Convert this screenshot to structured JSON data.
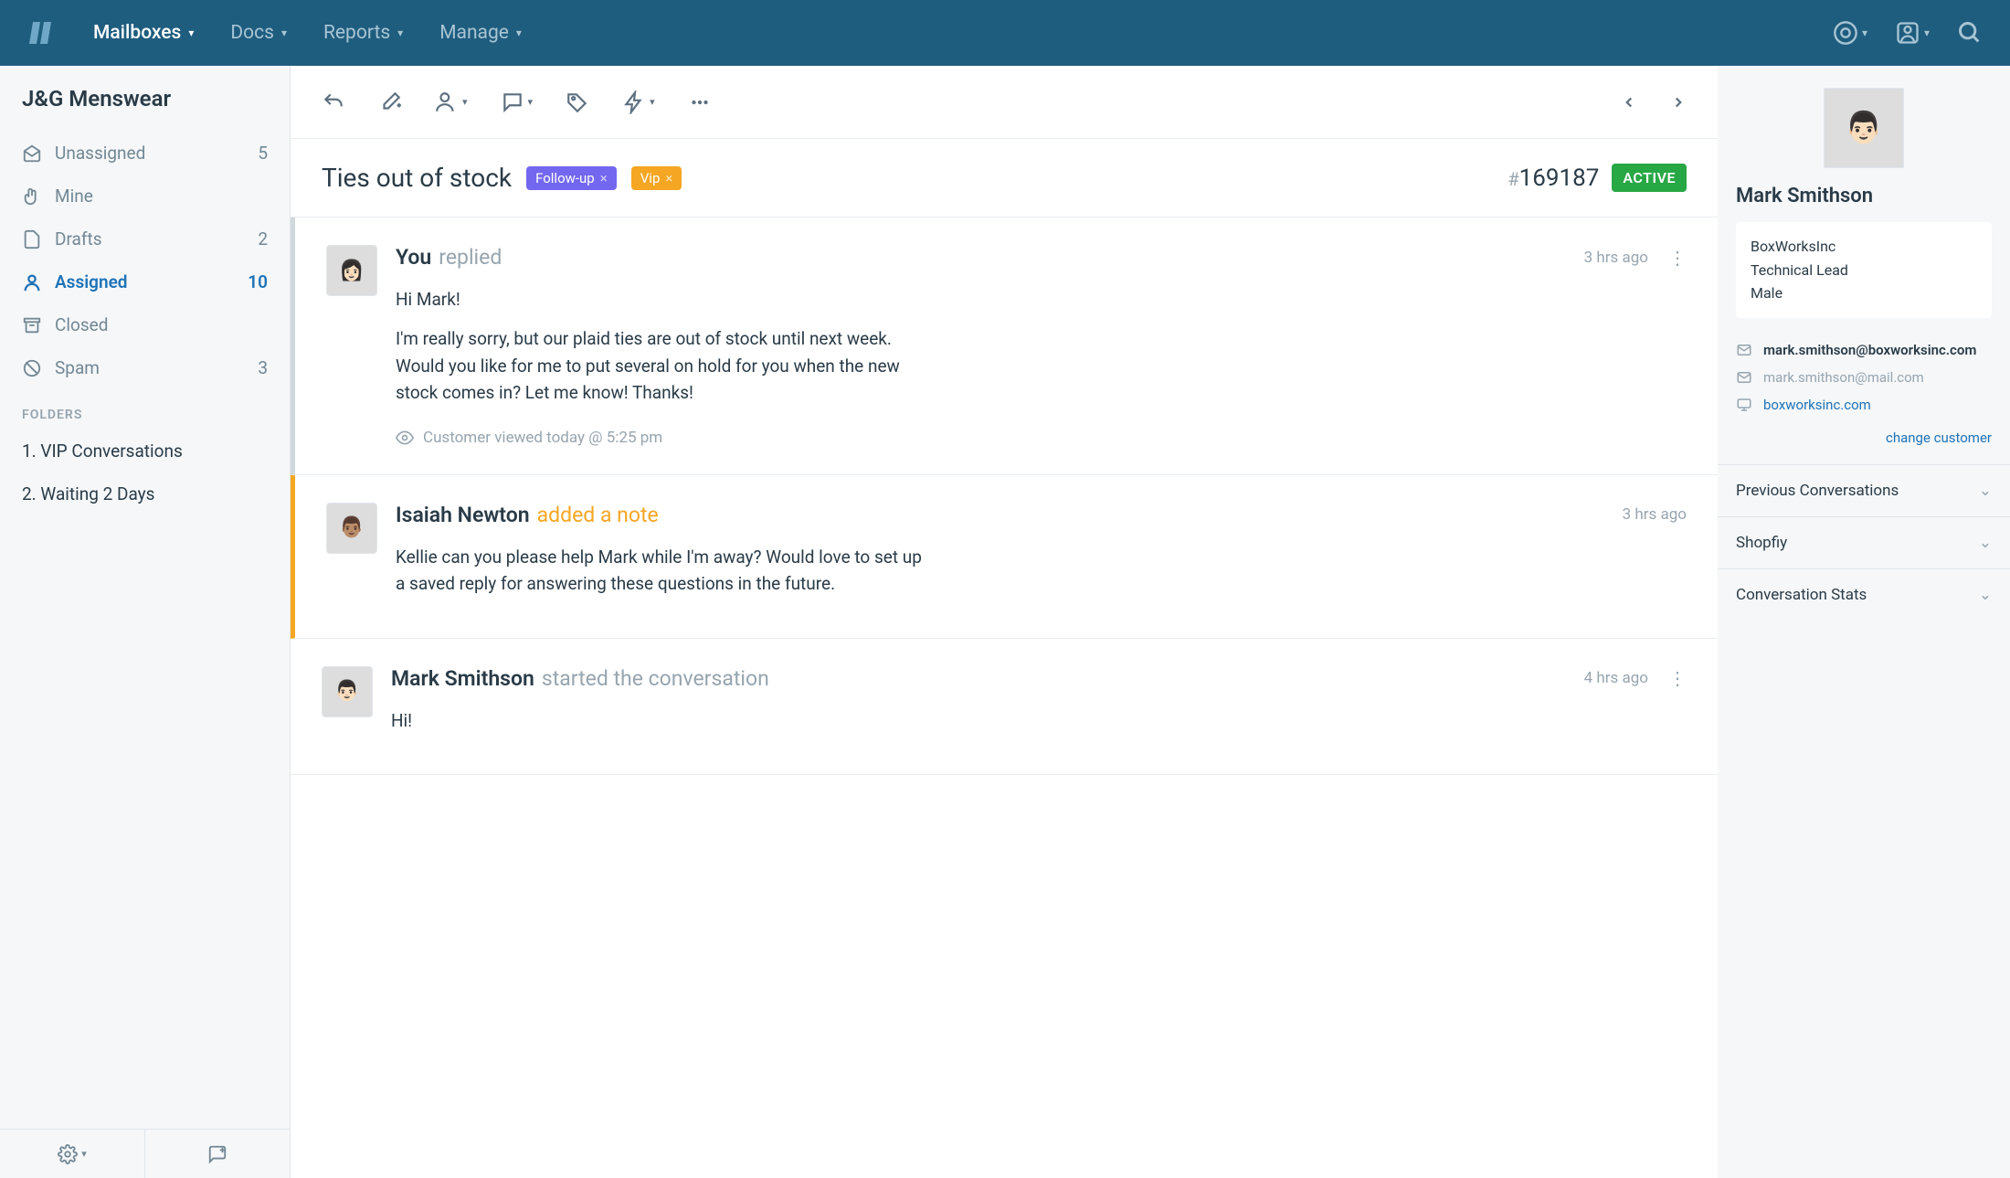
{
  "nav": {
    "items": [
      {
        "label": "Mailboxes",
        "active": true
      },
      {
        "label": "Docs",
        "active": false
      },
      {
        "label": "Reports",
        "active": false
      },
      {
        "label": "Manage",
        "active": false
      }
    ]
  },
  "mailbox": {
    "title": "J&G Menswear",
    "items": [
      {
        "id": "unassigned",
        "label": "Unassigned",
        "count": "5",
        "active": false
      },
      {
        "id": "mine",
        "label": "Mine",
        "count": "",
        "active": false
      },
      {
        "id": "drafts",
        "label": "Drafts",
        "count": "2",
        "active": false
      },
      {
        "id": "assigned",
        "label": "Assigned",
        "count": "10",
        "active": true
      },
      {
        "id": "closed",
        "label": "Closed",
        "count": "",
        "active": false
      },
      {
        "id": "spam",
        "label": "Spam",
        "count": "3",
        "active": false
      }
    ],
    "folders_header": "FOLDERS",
    "folders": [
      {
        "label": "1. VIP Conversations"
      },
      {
        "label": "2. Waiting 2 Days"
      }
    ]
  },
  "conversation": {
    "title": "Ties out of stock",
    "tags": [
      {
        "label": "Follow-up",
        "color": "purple"
      },
      {
        "label": "Vip",
        "color": "orange"
      }
    ],
    "id_hash": "#",
    "id": "169187",
    "status": "ACTIVE",
    "messages": [
      {
        "type": "reply",
        "author": "You",
        "action": "replied",
        "time": "3 hrs ago",
        "paragraphs": [
          "Hi Mark!",
          "I'm really sorry, but our plaid ties are out of stock until next week. Would you like for me to put several on hold for you when the new stock comes in? Let me know! Thanks!"
        ],
        "viewed": "Customer viewed today @ 5:25 pm",
        "avatar_initial": "👩🏻"
      },
      {
        "type": "note",
        "author": "Isaiah Newton",
        "action": "added a note",
        "time": "3 hrs ago",
        "paragraphs": [
          "Kellie can you please help Mark while I'm away? Would love to set up a saved reply for answering these questions in the future."
        ],
        "avatar_initial": "👨🏽"
      },
      {
        "type": "start",
        "author": "Mark Smithson",
        "action": "started the conversation",
        "time": "4 hrs ago",
        "paragraphs": [
          "Hi!"
        ],
        "avatar_initial": "👨🏻"
      }
    ]
  },
  "customer": {
    "name": "Mark Smithson",
    "company": "BoxWorksInc",
    "title": "Technical Lead",
    "gender": "Male",
    "email_primary": "mark.smithson@boxworksinc.com",
    "email_secondary": "mark.smithson@mail.com",
    "website": "boxworksinc.com",
    "change_label": "change customer",
    "accordion": [
      {
        "label": "Previous Conversations"
      },
      {
        "label": "Shopfiy"
      },
      {
        "label": "Conversation Stats"
      }
    ],
    "avatar_initial": "👨🏻"
  }
}
